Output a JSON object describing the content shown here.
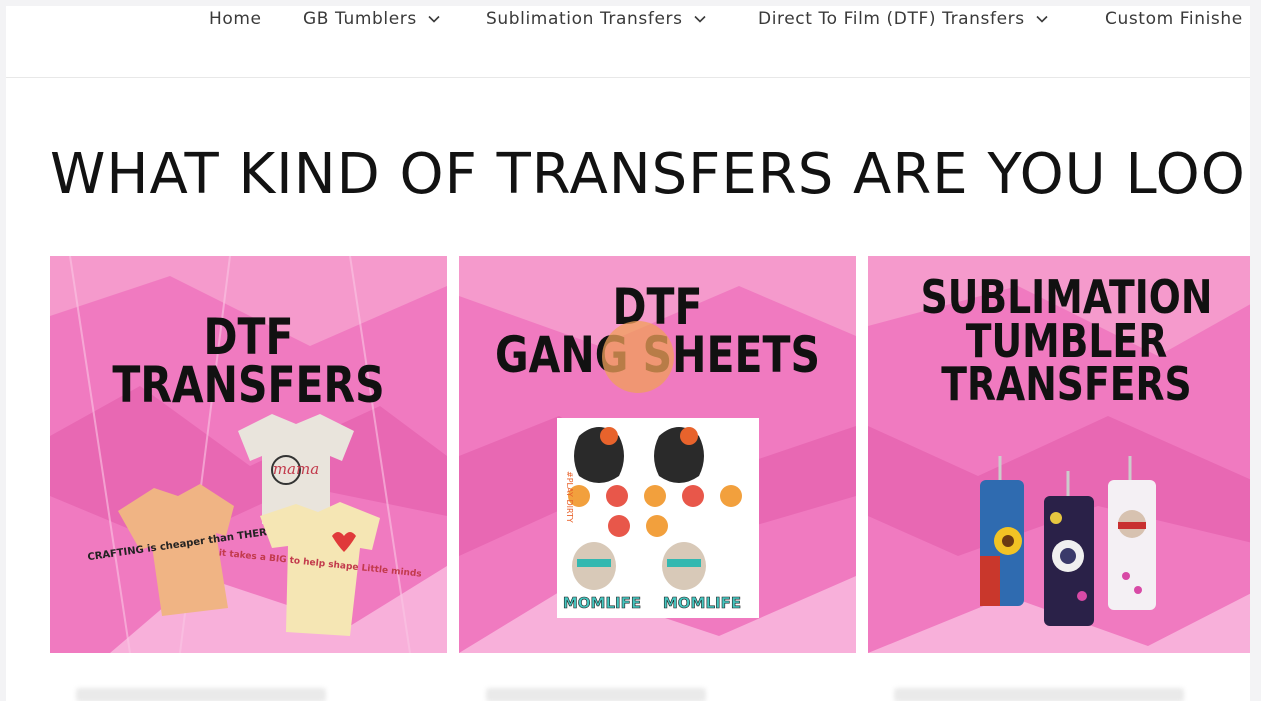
{
  "nav": {
    "items": [
      {
        "label": "Home",
        "dropdown": false
      },
      {
        "label": "GB Tumblers",
        "dropdown": true
      },
      {
        "label": "Sublimation Transfers",
        "dropdown": true
      },
      {
        "label": "Direct To Film (DTF) Transfers",
        "dropdown": true
      },
      {
        "label": "Custom Finishe",
        "dropdown": false
      }
    ]
  },
  "main": {
    "heading": "WHAT KIND OF TRANSFERS ARE YOU LOOI"
  },
  "cards": [
    {
      "title_lines": [
        "DTF TRANSFERS"
      ],
      "shirt_texts": [
        "mama",
        "CRAFTING is cheaper than THERAPY",
        "it takes a BIG to help shape Little minds"
      ]
    },
    {
      "title_lines": [
        "DTF",
        "GANG SHEETS"
      ],
      "sheet_texts": [
        "#PLAY DIRTY",
        "MOMLIFE",
        "MOMLIFE"
      ]
    },
    {
      "title_lines": [
        "SUBLIMATION",
        "TUMBLER",
        "TRANSFERS"
      ]
    }
  ],
  "colors": {
    "card_pink": "#f07ac0",
    "card_pink_light": "#f9a9d6",
    "card_pink_dark": "#e35aaa",
    "text": "#121212",
    "nav_text": "#3a3a3a"
  }
}
